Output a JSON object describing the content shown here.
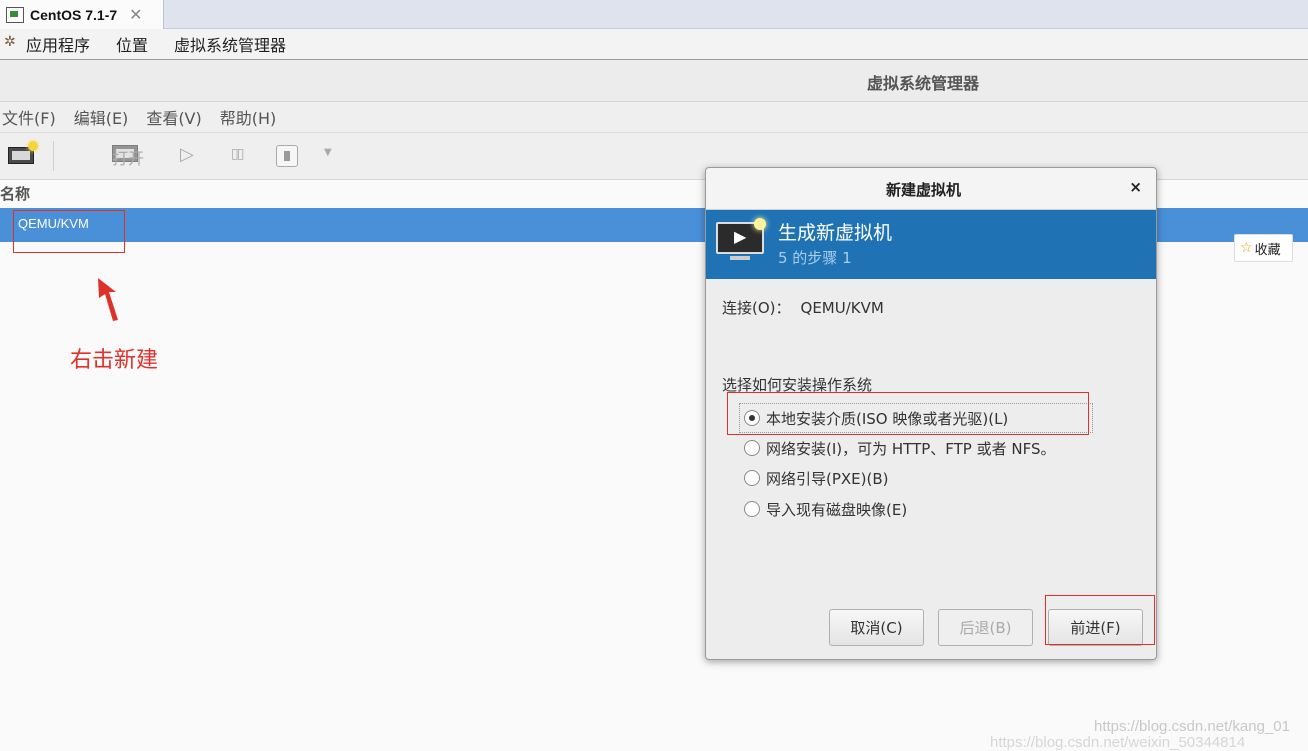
{
  "vm_tab": {
    "label": "CentOS 7.1-7",
    "close": "✕"
  },
  "gnome_menu": [
    "应用程序",
    "位置",
    "虚拟系统管理器"
  ],
  "window": {
    "title": "虚拟系统管理器"
  },
  "menubar": [
    "文件(F)",
    "编辑(E)",
    "查看(V)",
    "帮助(H)"
  ],
  "toolbar": {
    "open_label": "打开",
    "play": "▷",
    "pause": "▯▯",
    "more": "▼"
  },
  "list": {
    "header": "名称",
    "row": "QEMU/KVM"
  },
  "annotation": {
    "text": "右击新建",
    "color": "#e0302a"
  },
  "fav": {
    "label": "收藏",
    "icon": "☆"
  },
  "dialog": {
    "title": "新建虚拟机",
    "close": "×",
    "banner_title": "生成新虚拟机",
    "banner_sub": "5 的步骤 1",
    "conn_label": "连接(O)：",
    "conn_value": "QEMU/KVM",
    "choose_label": "选择如何安装操作系统",
    "options": [
      {
        "label": "本地安装介质(ISO 映像或者光驱)(L)",
        "selected": true
      },
      {
        "label": "网络安装(I)，可为 HTTP、FTP 或者 NFS。",
        "selected": false
      },
      {
        "label": "网络引导(PXE)(B)",
        "selected": false
      },
      {
        "label": "导入现有磁盘映像(E)",
        "selected": false
      }
    ],
    "buttons": {
      "cancel": "取消(C)",
      "back": "后退(B)",
      "forward": "前进(F)"
    }
  },
  "watermarks": [
    "https://blog.csdn.net/kang_01",
    "https://blog.csdn.net/weixin_50344814"
  ],
  "colors": {
    "accent": "#1f72b4",
    "selection": "#4a90d9",
    "annotation": "#e0302a"
  }
}
